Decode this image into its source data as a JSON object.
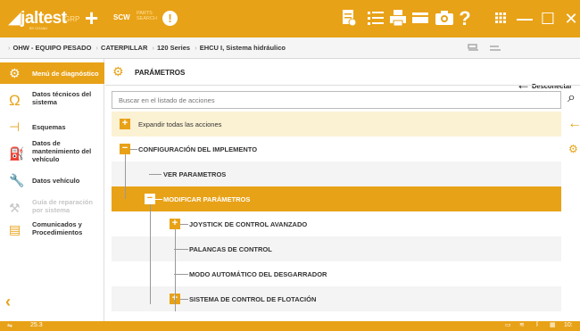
{
  "app": {
    "logo": "jaltest",
    "logo_sub": "BY COJALI",
    "grp": "GRP",
    "scw": "SCW",
    "parts_line1": "PARTS",
    "parts_line2": "SEARCH"
  },
  "toolbar": {
    "icons": [
      "report-icon",
      "list-icon",
      "print-icon",
      "card-icon",
      "camera-icon",
      "help-icon",
      "apps-icon"
    ],
    "minimize": "—",
    "maximize": "☐",
    "close": "✕"
  },
  "breadcrumb": [
    "OHW - EQUIPO PESADO",
    "CATERPILLAR",
    "120 Series",
    "EHCU I, Sistema hidráulico"
  ],
  "disconnect_label": "Desconectar",
  "sidebar": {
    "items": [
      {
        "label": "Menú de diagnóstico",
        "icon": "diagnosis-menu-icon",
        "state": "active"
      },
      {
        "label": "Datos técnicos del sistema",
        "icon": "ohm-icon",
        "state": "normal"
      },
      {
        "label": "Esquemas",
        "icon": "schema-icon",
        "state": "normal"
      },
      {
        "label": "Datos de mantenimiento del vehículo",
        "icon": "oil-can-icon",
        "state": "normal"
      },
      {
        "label": "Datos vehículo",
        "icon": "wrench-icon",
        "state": "normal"
      },
      {
        "label": "Guía de reparación por sistema",
        "icon": "tools-icon",
        "state": "disabled"
      },
      {
        "label": "Comunicados y Procedimientos",
        "icon": "documents-icon",
        "state": "normal"
      }
    ]
  },
  "main": {
    "title": "PARÁMETROS",
    "search_placeholder": "Buscar en el listado de acciones",
    "expand_all": "Expandir todas las acciones",
    "tree": [
      {
        "label": "CONFIGURACIÓN DEL IMPLEMENTO",
        "toggle": "−"
      },
      {
        "label": "VER PARAMETROS",
        "toggle": ""
      },
      {
        "label": "MODIFICAR PARÁMETROS",
        "toggle": "−"
      },
      {
        "label": "JOYSTICK DE CONTROL AVANZADO",
        "toggle": "+"
      },
      {
        "label": "PALANCAS DE CONTROL",
        "toggle": ""
      },
      {
        "label": "MODO AUTOMÁTICO DEL DESGARRADOR",
        "toggle": ""
      },
      {
        "label": "SISTEMA DE CONTROL DE FLOTACIÓN",
        "toggle": "+"
      }
    ]
  },
  "status": {
    "version": "25.3",
    "clock": "10:"
  },
  "colors": {
    "accent": "#e8a217",
    "selected_row": "#e8a217",
    "light_row": "#fbf1d3",
    "grey_row": "#f4f4f4"
  }
}
